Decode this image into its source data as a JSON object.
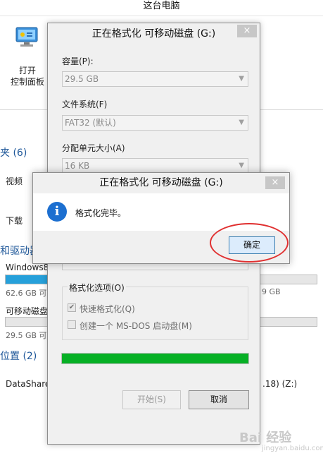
{
  "explorer": {
    "window_title": "这台电脑",
    "ribbon": {
      "control_panel_line1": "打开",
      "control_panel_line2": "控制面板"
    },
    "folders_header": "夹 (6)",
    "folders": [
      "视频",
      "下载"
    ],
    "devices_header": "和驱动器",
    "drives": [
      {
        "name": "Windows8",
        "size_text": "62.6 GB 可用",
        "right_text": "9 GB",
        "used_fraction": 0.72
      },
      {
        "name": "可移动磁盘",
        "size_text": "29.5 GB 可用",
        "used_fraction": 0.0
      }
    ],
    "network_header": "位置 (2)",
    "network_item": "DataShare",
    "network_item_right": ".18) (Z:)"
  },
  "format_dialog": {
    "title": "正在格式化 可移动磁盘 (G:)",
    "close_glyph": "×",
    "capacity_label": "容量(P):",
    "capacity_value": "29.5 GB",
    "filesystem_label": "文件系统(F)",
    "filesystem_value": "FAT32 (默认)",
    "alloc_label": "分配单元大小(A)",
    "alloc_value": "16 KB",
    "options_legend": "格式化选项(O)",
    "quick_format_label": "快速格式化(Q)",
    "quick_format_checked": true,
    "msdos_label": "创建一个 MS-DOS 启动盘(M)",
    "msdos_checked": false,
    "progress_fraction": 1.0,
    "start_button": "开始(S)",
    "cancel_button": "取消"
  },
  "message_box": {
    "title": "正在格式化 可移动磁盘 (G:)",
    "close_glyph": "×",
    "icon": "info-icon",
    "message": "格式化完毕。",
    "ok_button": "确定"
  },
  "colors": {
    "progress_green": "#06b025",
    "info_blue": "#1c6fd0",
    "annotation_red": "#e03030",
    "drive_bar_blue": "#26a0da"
  },
  "watermark": {
    "brand": "Bai 经验",
    "url": "jingyan.baidu.com"
  }
}
